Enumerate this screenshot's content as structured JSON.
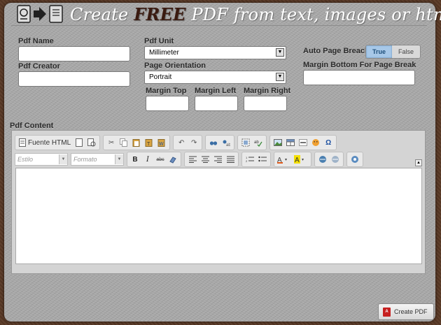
{
  "header": {
    "title_prefix": "Create ",
    "title_free": "FREE",
    "title_suffix": " PDF from text, images or html",
    "logo_icons": [
      "document-icon",
      "arrow-right-icon",
      "pdf-file-icon"
    ]
  },
  "form": {
    "pdf_name": {
      "label": "Pdf Name",
      "value": ""
    },
    "pdf_creator": {
      "label": "Pdf Creator",
      "value": ""
    },
    "pdf_unit": {
      "label": "Pdf Unit",
      "value": "Millimeter"
    },
    "page_orientation": {
      "label": "Page Orientation",
      "value": "Portrait"
    },
    "margin_top": {
      "label": "Margin Top",
      "value": ""
    },
    "margin_left": {
      "label": "Margin Left",
      "value": ""
    },
    "margin_right": {
      "label": "Margin Right",
      "value": ""
    },
    "auto_page_break": {
      "label": "Auto Page Breack",
      "true_label": "True",
      "false_label": "False",
      "selected": "True"
    },
    "margin_bottom": {
      "label": "Margin Bottom For Page Break",
      "value": ""
    },
    "pdf_content": {
      "label": "Pdf Content",
      "value": ""
    }
  },
  "editor": {
    "source_label": "Fuente HTML",
    "style_placeholder": "Estilo",
    "format_placeholder": "Formato",
    "bold": "B",
    "italic": "I",
    "strike": "abc",
    "omega": "Ω"
  },
  "actions": {
    "create_pdf": "Create PDF"
  },
  "colors": {
    "panel": "#a7a7a7",
    "toggle_active": "#a7c8e8",
    "title_free": "#3a1a10",
    "pdf_red": "#c62020"
  }
}
